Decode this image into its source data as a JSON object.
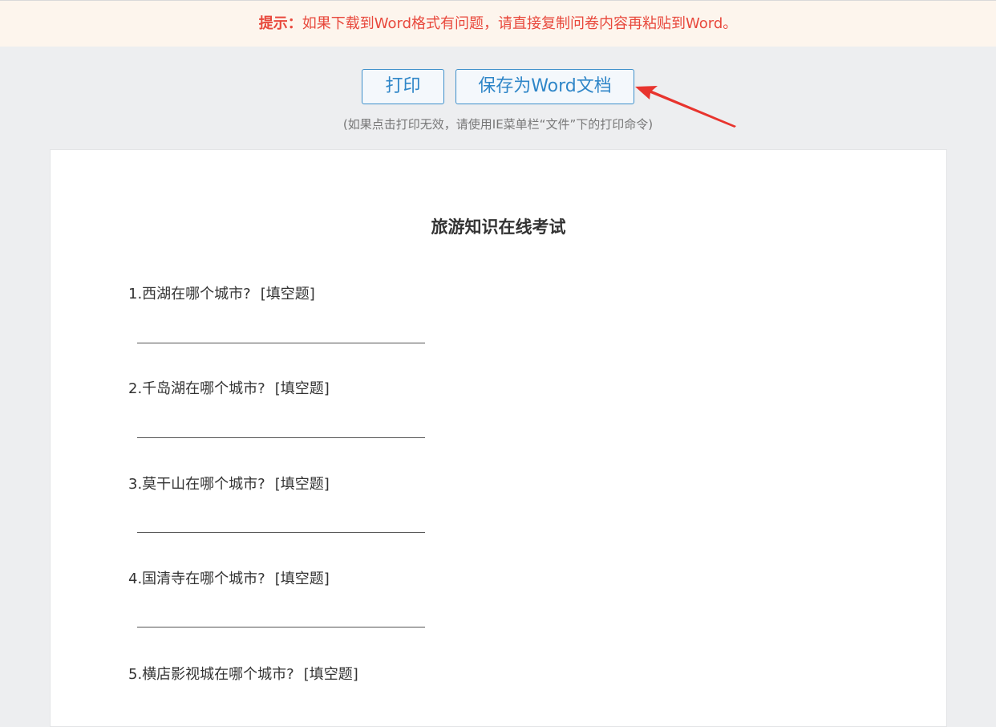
{
  "tip": {
    "label": "提示：",
    "text": "如果下载到Word格式有问题，请直接复制问卷内容再粘贴到Word。"
  },
  "toolbar": {
    "print_label": "打印",
    "save_word_label": "保存为Word文档",
    "print_hint": "(如果点击打印无效，请使用IE菜单栏“文件”下的打印命令)"
  },
  "colors": {
    "tip_text": "#e8483c",
    "tip_background": "#fdf5ed",
    "button_accent": "#2f86c8",
    "arrow": "#e8342e"
  },
  "annotation": {
    "arrow_icon": "red-arrow-pointing-left"
  },
  "exam": {
    "title": "旅游知识在线考试",
    "questions": [
      {
        "text": "1.西湖在哪个城市?",
        "type": "[填空题]"
      },
      {
        "text": "2.千岛湖在哪个城市?",
        "type": "[填空题]"
      },
      {
        "text": "3.莫干山在哪个城市?",
        "type": "[填空题]"
      },
      {
        "text": "4.国清寺在哪个城市?",
        "type": "[填空题]"
      },
      {
        "text": "5.横店影视城在哪个城市?",
        "type": "[填空题]"
      }
    ]
  }
}
